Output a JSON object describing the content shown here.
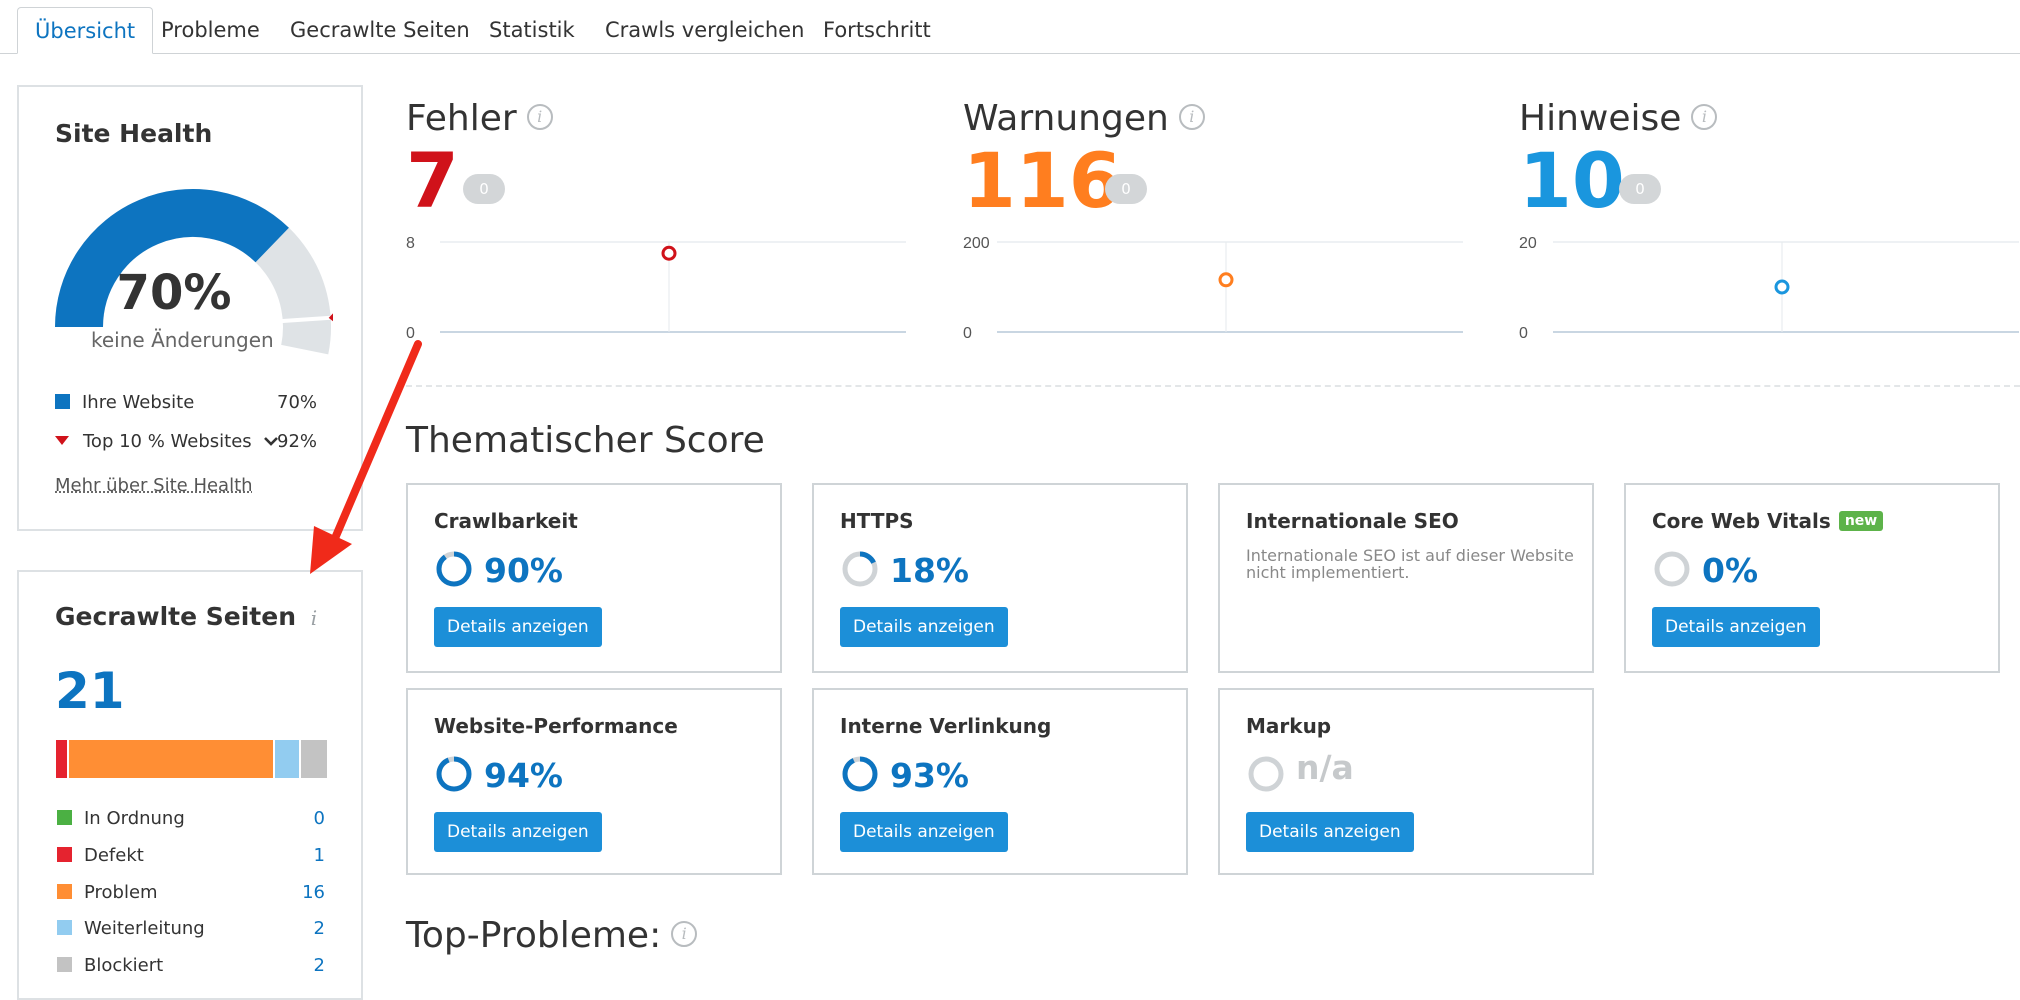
{
  "tabs": [
    {
      "label": "Übersicht",
      "active": true
    },
    {
      "label": "Probleme"
    },
    {
      "label": "Gecrawlte Seiten"
    },
    {
      "label": "Statistik"
    },
    {
      "label": "Crawls vergleichen"
    },
    {
      "label": "Fortschritt"
    }
  ],
  "site_health": {
    "title": "Site Health",
    "value": "70%",
    "subtitle": "keine Änderungen",
    "score_fraction": 0.7,
    "benchmark_fraction": 0.92,
    "legend": [
      {
        "label": "Ihre Website",
        "value": "70%",
        "color": "#0d74c0"
      },
      {
        "label": "Top 10 % Websites",
        "value": "92%",
        "color": "#d0121a"
      }
    ],
    "more_link": "Mehr über Site Health"
  },
  "crawled": {
    "title": "Gecrawlte Seiten",
    "count": "21",
    "statuses": [
      {
        "label": "In Ordnung",
        "value": "0",
        "count": 0,
        "color": "#4bb043"
      },
      {
        "label": "Defekt",
        "value": "1",
        "count": 1,
        "color": "#e5232f"
      },
      {
        "label": "Problem",
        "value": "16",
        "count": 16,
        "color": "#ff8e34"
      },
      {
        "label": "Weiterleitung",
        "value": "2",
        "count": 2,
        "color": "#92ccf0"
      },
      {
        "label": "Blockiert",
        "value": "2",
        "count": 2,
        "color": "#c3c3c3"
      }
    ]
  },
  "metrics": [
    {
      "title": "Fehler",
      "value": "7",
      "badge": "0",
      "color": "#d0121a",
      "y_top": "8",
      "y_bottom": "0",
      "point": 7,
      "max": 8
    },
    {
      "title": "Warnungen",
      "value": "116",
      "badge": "0",
      "color": "#ff7e1f",
      "y_top": "200",
      "y_bottom": "0",
      "point": 116,
      "max": 200
    },
    {
      "title": "Hinweise",
      "value": "10",
      "badge": "0",
      "color": "#1a96de",
      "y_top": "20",
      "y_bottom": "0",
      "point": 10,
      "max": 20
    }
  ],
  "thematic": {
    "title": "Thematischer Score",
    "cards": [
      {
        "title": "Crawlbarkeit",
        "value": "90%",
        "fraction": 0.9,
        "button": "Details anzeigen"
      },
      {
        "title": "HTTPS",
        "value": "18%",
        "fraction": 0.18,
        "button": "Details anzeigen"
      },
      {
        "title": "Internationale SEO",
        "note": "Internationale SEO ist auf dieser Website nicht implementiert."
      },
      {
        "title": "Core Web Vitals",
        "badge": "new",
        "value": "0%",
        "fraction": 0,
        "button": "Details anzeigen"
      },
      {
        "title": "Website-Performance",
        "value": "94%",
        "fraction": 0.94,
        "button": "Details anzeigen"
      },
      {
        "title": "Interne Verlinkung",
        "value": "93%",
        "fraction": 0.93,
        "button": "Details anzeigen"
      },
      {
        "title": "Markup",
        "value": "n/a",
        "fraction": 0,
        "button": "Details anzeigen"
      }
    ]
  },
  "top_problems": {
    "title": "Top-Probleme:"
  },
  "colors": {
    "accent": "#0d74c0",
    "button": "#1c8fd8",
    "arrow": "#f02a1a"
  }
}
